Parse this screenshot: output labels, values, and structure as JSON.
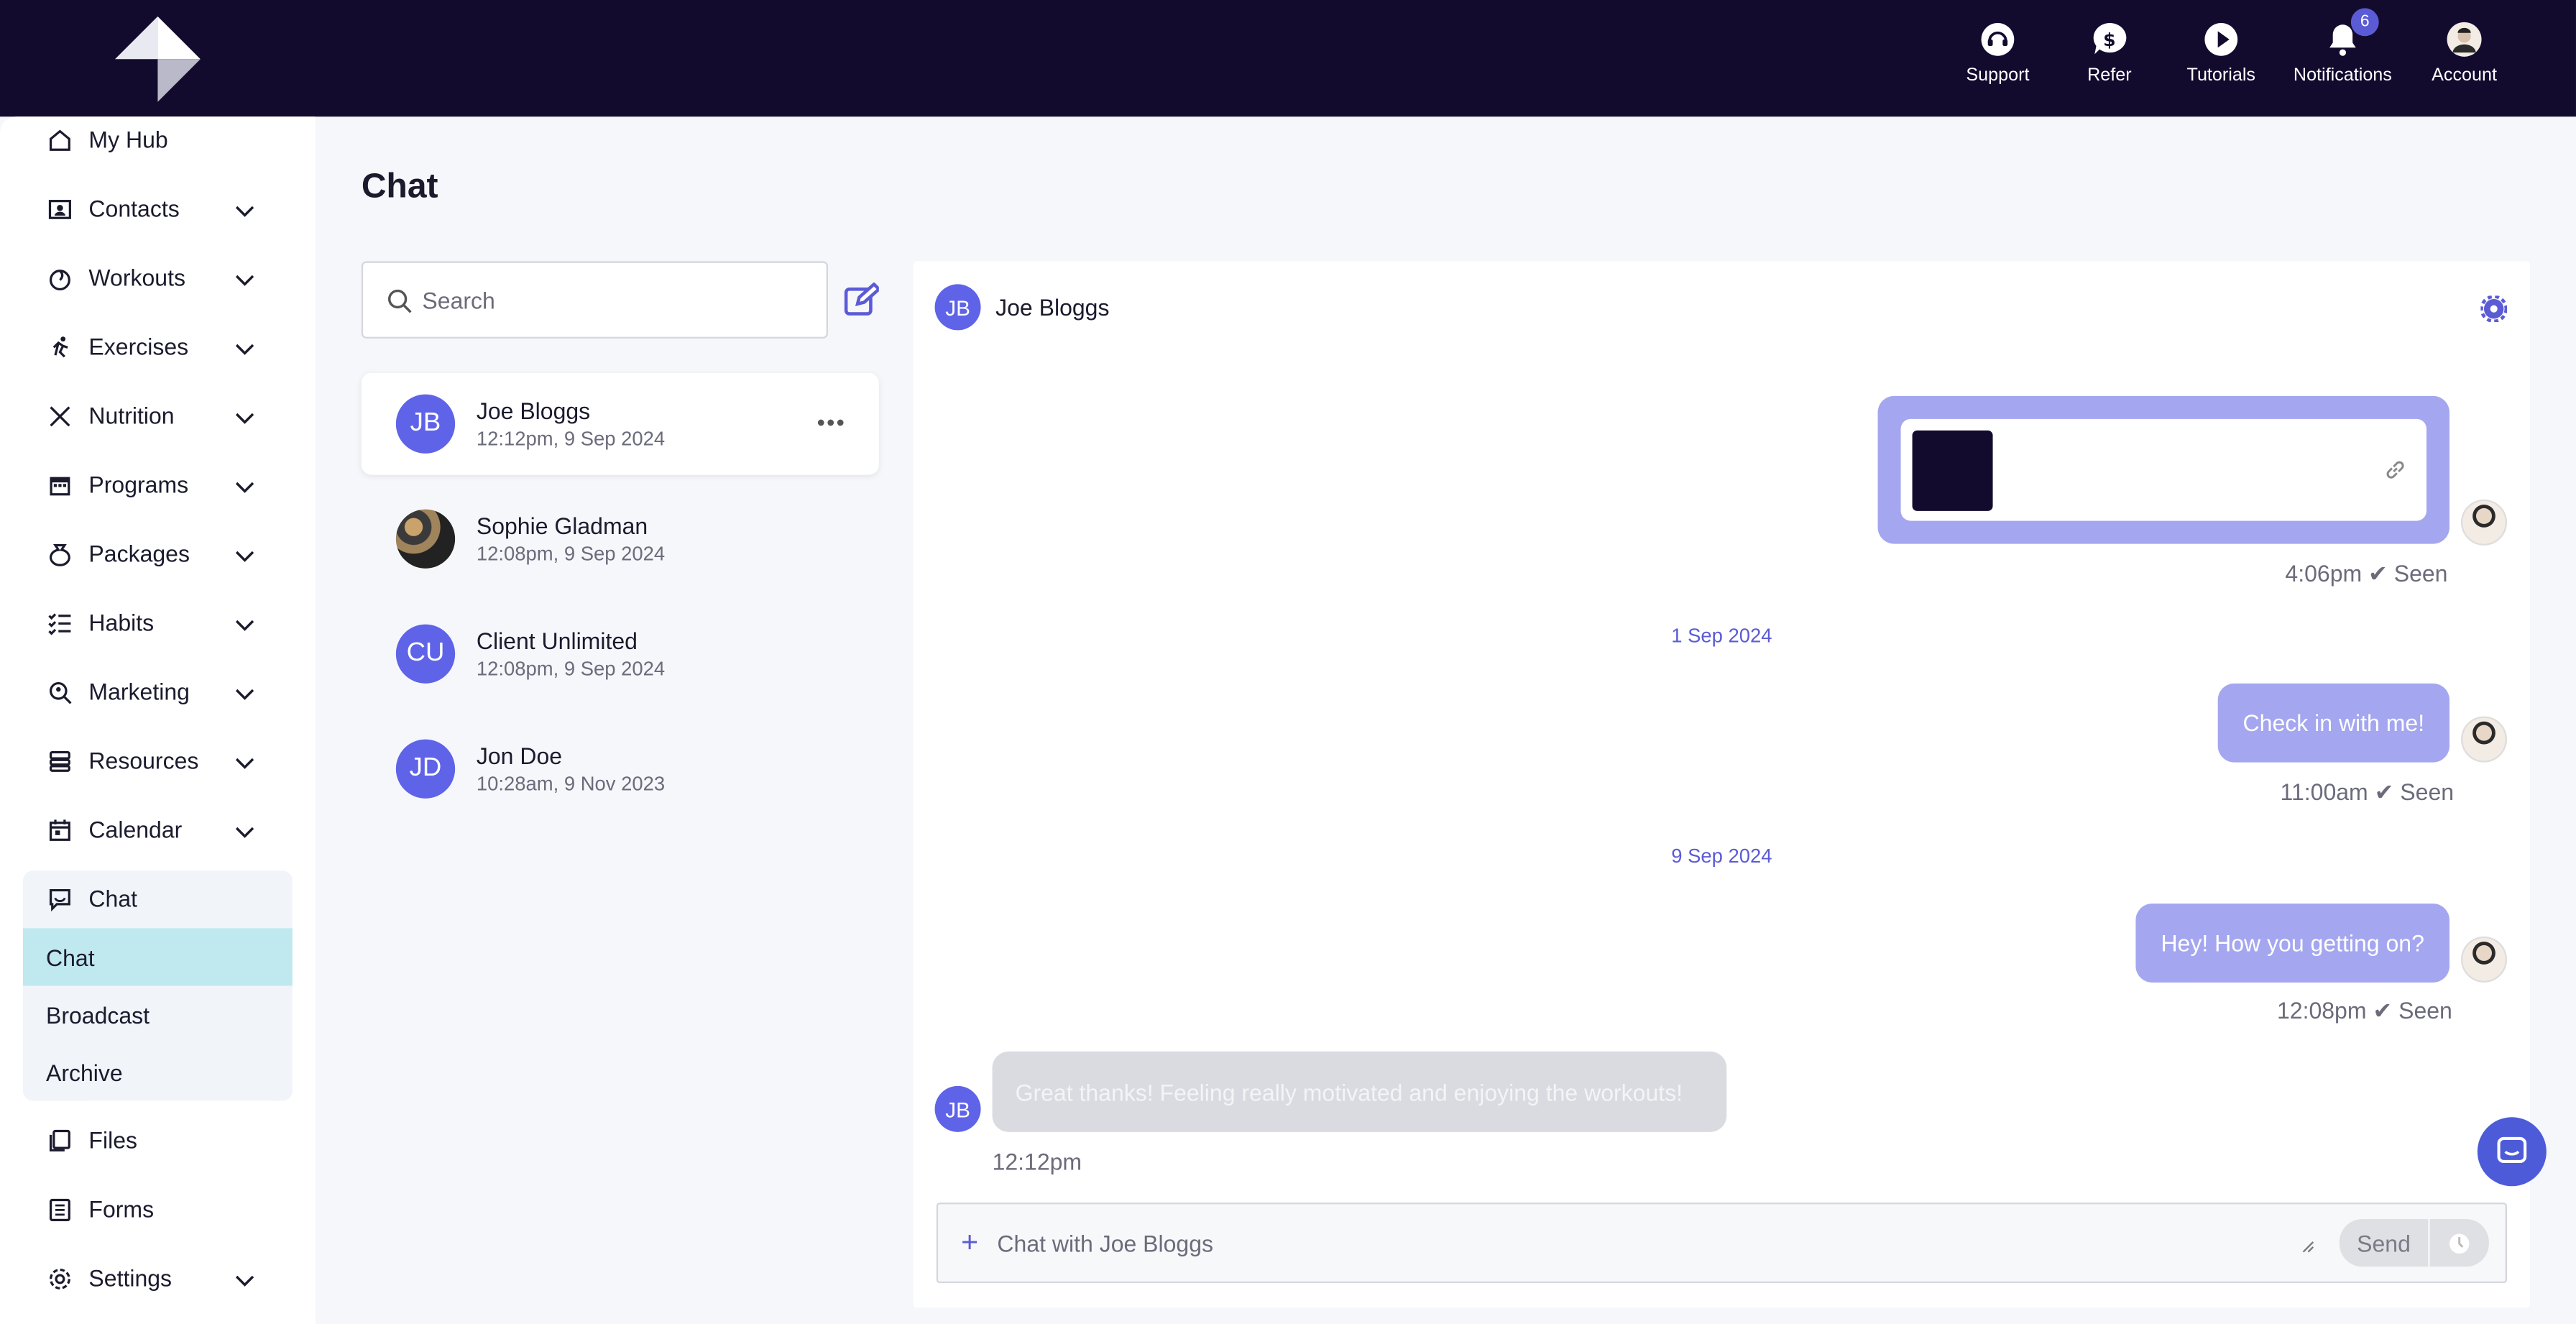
{
  "topbar": {
    "actions": [
      {
        "label": "Support",
        "icon": "headset-icon"
      },
      {
        "label": "Refer",
        "icon": "dollar-chat-icon"
      },
      {
        "label": "Tutorials",
        "icon": "play-icon"
      },
      {
        "label": "Notifications",
        "icon": "bell-icon",
        "badge": "6"
      },
      {
        "label": "Account",
        "icon": "account-avatar"
      }
    ]
  },
  "sidebar": {
    "items": [
      {
        "label": "My Hub"
      },
      {
        "label": "Contacts"
      },
      {
        "label": "Workouts"
      },
      {
        "label": "Exercises"
      },
      {
        "label": "Nutrition"
      },
      {
        "label": "Programs"
      },
      {
        "label": "Packages"
      },
      {
        "label": "Habits"
      },
      {
        "label": "Marketing"
      },
      {
        "label": "Resources"
      },
      {
        "label": "Calendar"
      },
      {
        "label": "Chat"
      },
      {
        "label": "Files"
      },
      {
        "label": "Forms"
      },
      {
        "label": "Settings"
      }
    ],
    "chat_sub": [
      "Chat",
      "Broadcast",
      "Archive"
    ]
  },
  "page": {
    "title": "Chat",
    "search_placeholder": "Search"
  },
  "conversations": [
    {
      "initials": "JB",
      "name": "Joe Bloggs",
      "time": "12:12pm, 9 Sep 2024"
    },
    {
      "initials": "",
      "name": "Sophie Gladman",
      "time": "12:08pm, 9 Sep 2024"
    },
    {
      "initials": "CU",
      "name": "Client Unlimited",
      "time": "12:08pm, 9 Sep 2024"
    },
    {
      "initials": "JD",
      "name": "Jon Doe",
      "time": "10:28am, 9 Nov 2023"
    }
  ],
  "chat": {
    "contact_initials": "JB",
    "contact_name": "Joe Bloggs",
    "messages": [
      {
        "meta": "4:06pm ✔ Seen"
      },
      {
        "date": "1 Sep 2024"
      },
      {
        "text": "Check in with me!",
        "meta": "11:00am ✔ Seen"
      },
      {
        "date": "9 Sep 2024"
      },
      {
        "text": "Hey! How you getting on?",
        "meta": "12:08pm ✔ Seen"
      },
      {
        "initials": "JB",
        "text": "Great thanks! Feeling really motivated and enjoying the workouts!",
        "meta": "12:12pm"
      }
    ],
    "composer_placeholder": "Chat with Joe  Bloggs",
    "send_label": "Send"
  },
  "colors": {
    "topbar": "#130b2e",
    "accent": "#5b5bd6",
    "bubble_out": "#a4a6ef",
    "bubble_in": "#d9dbe0",
    "active_sub": "#bfe9ef"
  }
}
